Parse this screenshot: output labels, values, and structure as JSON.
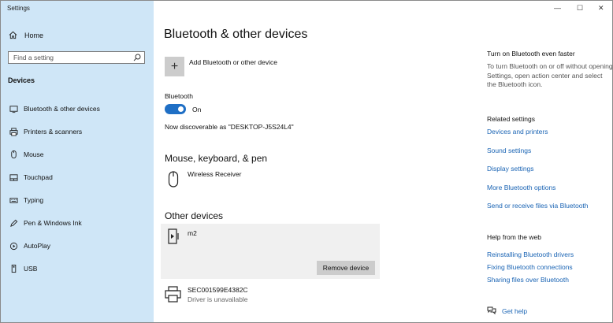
{
  "window": {
    "title": "Settings",
    "controls": {
      "minimize": "—",
      "maximize": "☐",
      "close": "✕"
    }
  },
  "sidebar": {
    "home_label": "Home",
    "search_placeholder": "Find a setting",
    "section": "Devices",
    "items": [
      {
        "label": "Bluetooth & other devices",
        "icon": "bluetooth-icon"
      },
      {
        "label": "Printers & scanners",
        "icon": "printer-icon"
      },
      {
        "label": "Mouse",
        "icon": "mouse-icon"
      },
      {
        "label": "Touchpad",
        "icon": "touchpad-icon"
      },
      {
        "label": "Typing",
        "icon": "keyboard-icon"
      },
      {
        "label": "Pen & Windows Ink",
        "icon": "pen-icon"
      },
      {
        "label": "AutoPlay",
        "icon": "autoplay-icon"
      },
      {
        "label": "USB",
        "icon": "usb-icon"
      }
    ]
  },
  "main": {
    "title": "Bluetooth & other devices",
    "add_label": "Add Bluetooth or other device",
    "bluetooth_label": "Bluetooth",
    "toggle_state": "On",
    "discoverable": "Now discoverable as \"DESKTOP-J5S24L4\"",
    "mouse_section": "Mouse, keyboard, & pen",
    "wireless_receiver": "Wireless Receiver",
    "other_section": "Other devices",
    "device_m2": "m2",
    "remove_button": "Remove device",
    "device_sec": "SEC001599E4382C",
    "device_sec_status": "Driver is unavailable"
  },
  "right": {
    "faster_title": "Turn on Bluetooth even faster",
    "faster_text": "To turn Bluetooth on or off without opening Settings, open action center and select the Bluetooth icon.",
    "related_title": "Related settings",
    "related_links": [
      "Devices and printers",
      "Sound settings",
      "Display settings",
      "More Bluetooth options",
      "Send or receive files via Bluetooth"
    ],
    "help_title": "Help from the web",
    "help_links": [
      "Reinstalling Bluetooth drivers",
      "Fixing Bluetooth connections",
      "Sharing files over Bluetooth"
    ],
    "get_help": "Get help"
  },
  "colors": {
    "sidebar_bg": "#cfe6f7",
    "accent": "#1f6fc5",
    "link": "#1a64b4"
  }
}
